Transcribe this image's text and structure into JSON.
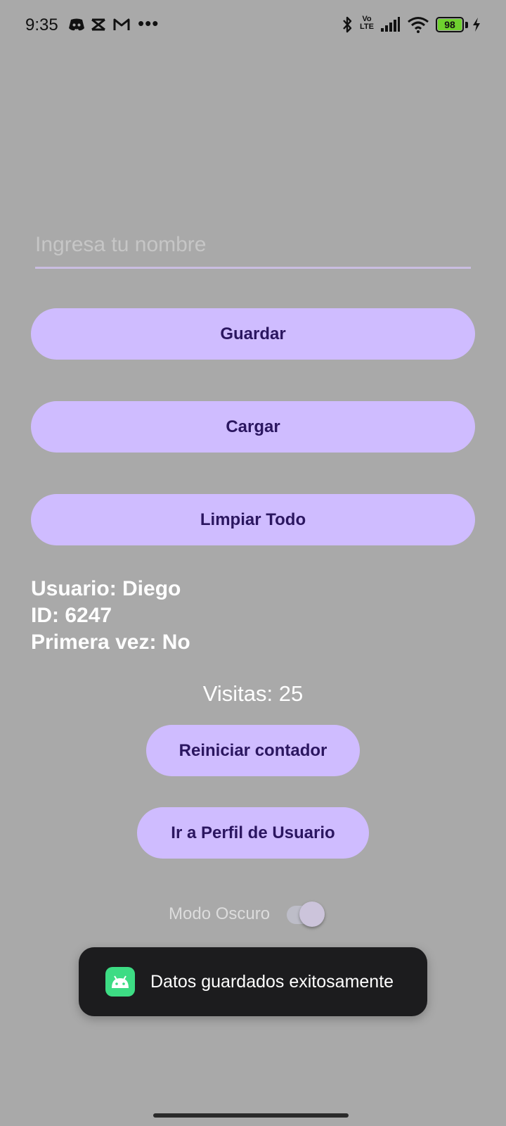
{
  "status_bar": {
    "time": "9:35",
    "notification_icons": [
      "discord-icon",
      "capcut-icon",
      "gmail-icon"
    ],
    "ellipsis": "•••",
    "volte": "Vo\nLTE",
    "battery_level": "98",
    "charging": true
  },
  "form": {
    "name_placeholder": "Ingresa tu nombre",
    "name_value": ""
  },
  "buttons": {
    "save": "Guardar",
    "load": "Cargar",
    "clear_all": "Limpiar Todo",
    "reset_counter": "Reiniciar contador",
    "go_profile": "Ir a Perfil de Usuario"
  },
  "user_info": {
    "user_line": "Usuario: Diego",
    "id_line": "ID: 6247",
    "first_time_line": "Primera vez: No"
  },
  "counter": {
    "visits_text": "Visitas: 25"
  },
  "dark_mode": {
    "label": "Modo Oscuro",
    "enabled": true
  },
  "toast": {
    "message": "Datos guardados exitosamente"
  },
  "colors": {
    "background": "#a9a9a9",
    "button_bg": "#cfbcff",
    "button_text": "#2b1660",
    "toast_bg": "#1c1c1e",
    "android_green": "#3ddc84",
    "battery_green": "#6fd12f"
  }
}
